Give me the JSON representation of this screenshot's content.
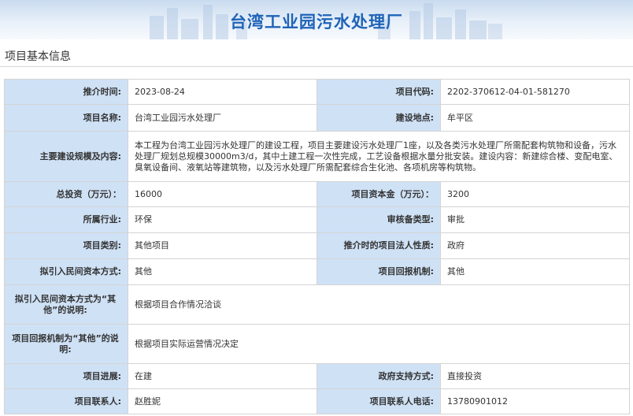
{
  "banner": {
    "title": "台湾工业园污水处理厂"
  },
  "section": {
    "title": "项目基本信息"
  },
  "rows": [
    {
      "type": "pair",
      "k1": "推介时间:",
      "v1": "2023-08-24",
      "k2": "项目代码:",
      "v2": "2202-370612-04-01-581270"
    },
    {
      "type": "pair",
      "k1": "项目名称:",
      "v1": "台湾工业园污水处理厂",
      "k2": "建设地点:",
      "v2": "牟平区"
    },
    {
      "type": "full",
      "k": "主要建设规模及内容:",
      "v": "本工程为台湾工业园污水处理厂的建设工程，项目主要建设污水处理厂1座，以及各类污水处理厂所需配套构筑物和设备，污水处理厂规划总规模30000m3/d，其中土建工程一次性完成，工艺设备根据水量分批安装。建设内容：新建综合楼、变配电室、臭氧设备间、液氧站等建筑物，以及污水处理厂所需配套综合生化池、各项机房等构筑物。"
    },
    {
      "type": "pair",
      "k1": "总投资（万元）：",
      "v1": "16000",
      "k2": "项目资本金（万元）：",
      "v2": "3200"
    },
    {
      "type": "pair",
      "k1": "所属行业:",
      "v1": "环保",
      "k2": "审核备类型:",
      "v2": "审批"
    },
    {
      "type": "pair",
      "k1": "项目类别:",
      "v1": "其他项目",
      "k2": "推介时的项目法人性质:",
      "v2": "政府"
    },
    {
      "type": "pair",
      "k1": "拟引入民间资本方式:",
      "v1": "其他",
      "k2": "项目回报机制:",
      "v2": "其他"
    },
    {
      "type": "full",
      "k": "拟引入民间资本方式为“其他”的说明:",
      "v": "根据项目合作情况洽谈"
    },
    {
      "type": "full",
      "k": "项目回报机制为“其他”的说明:",
      "v": "根据项目实际运营情况决定"
    },
    {
      "type": "pair",
      "k1": "项目进展:",
      "v1": "在建",
      "k2": "政府支持方式:",
      "v2": "直接投资"
    },
    {
      "type": "pair",
      "k1": "项目联系人:",
      "v1": "赵胜妮",
      "k2": "项目联系人电话:",
      "v2": "13780901012"
    }
  ]
}
